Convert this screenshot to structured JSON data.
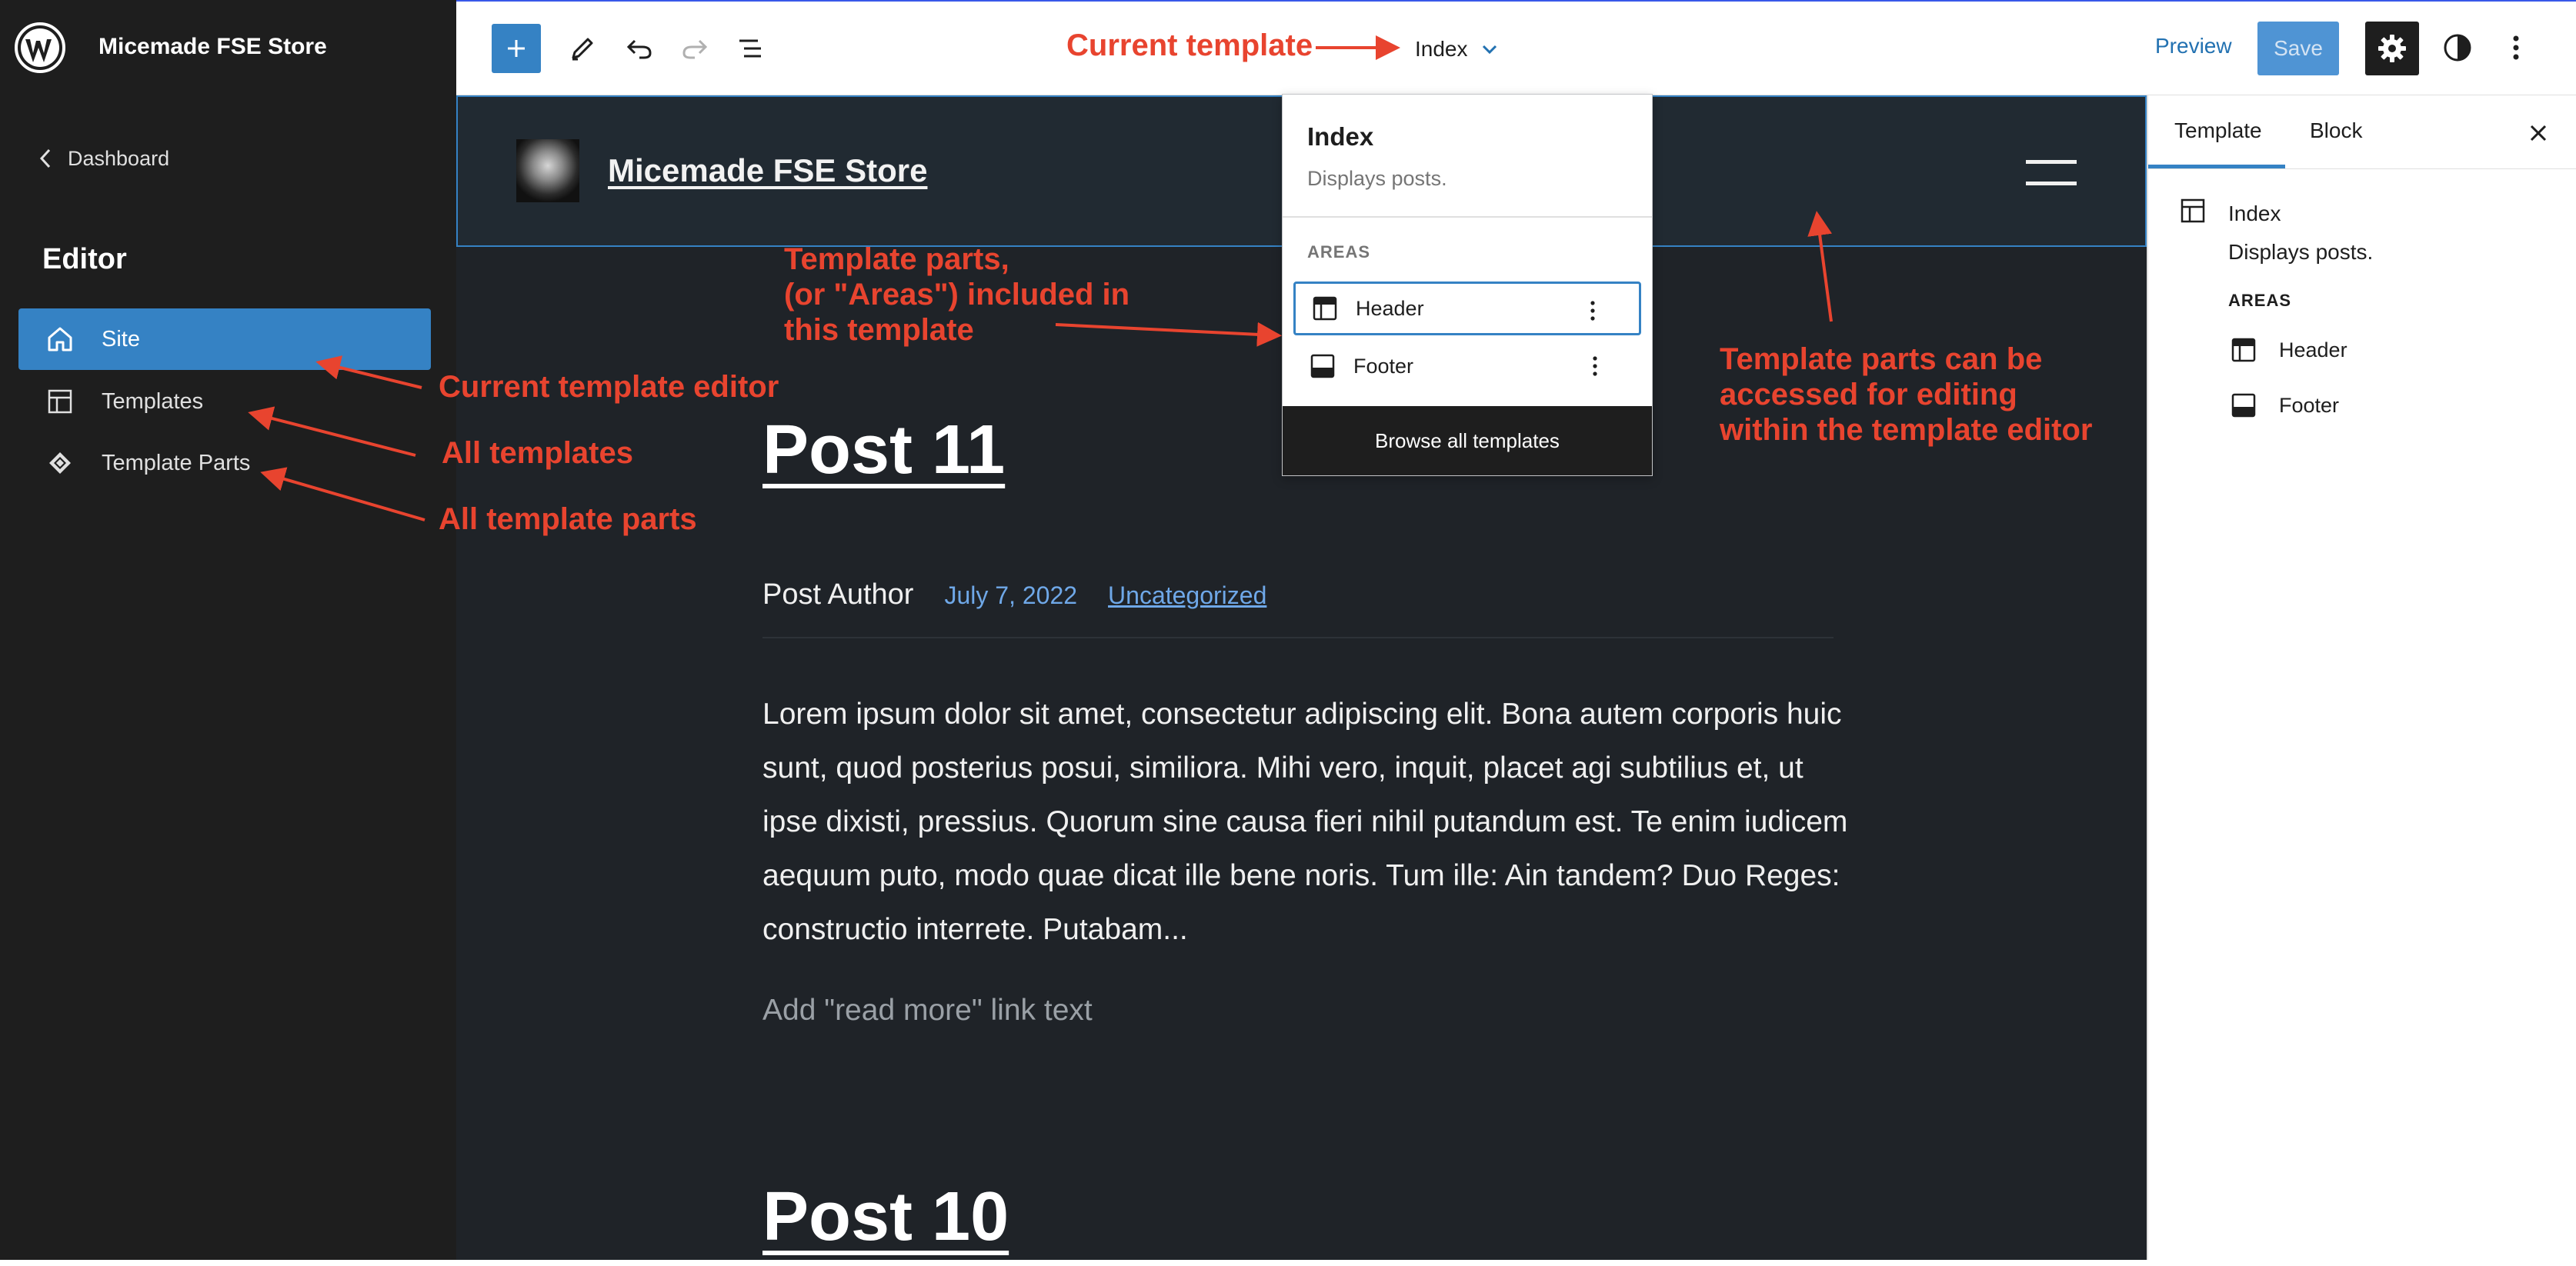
{
  "app": {
    "site_name": "Micemade FSE Store",
    "accent_color": "#3582c4",
    "annotation_color": "#e8442f"
  },
  "sidebar": {
    "back_link": "Dashboard",
    "heading": "Editor",
    "items": [
      {
        "label": "Site",
        "icon": "home-icon",
        "active": true
      },
      {
        "label": "Templates",
        "icon": "layout-icon",
        "active": false
      },
      {
        "label": "Template Parts",
        "icon": "symbol-icon",
        "active": false
      }
    ]
  },
  "toolbar": {
    "template_name": "Index",
    "preview_label": "Preview",
    "save_label": "Save",
    "icons": [
      "plus-icon",
      "pencil-icon",
      "undo-icon",
      "redo-icon",
      "list-view-icon",
      "gear-icon",
      "contrast-icon",
      "more-vertical-icon"
    ]
  },
  "template_dropdown": {
    "title": "Index",
    "description": "Displays posts.",
    "areas_heading": "AREAS",
    "areas": [
      {
        "label": "Header",
        "icon": "header-icon"
      },
      {
        "label": "Footer",
        "icon": "footer-icon"
      }
    ],
    "browse_label": "Browse all templates"
  },
  "canvas": {
    "site_title": "Micemade FSE Store",
    "posts": [
      {
        "title": "Post 11",
        "author": "Post Author",
        "date": "July 7, 2022",
        "category": "Uncategorized",
        "excerpt": "Lorem ipsum dolor sit amet, consectetur adipiscing elit. Bona autem corporis huic sunt, quod posterius posui, similiora. Mihi vero, inquit, placet agi subtilius et, ut ipse dixisti, pressius. Quorum sine causa fieri nihil putandum est. Te enim iudicem aequum puto, modo quae dicat ille bene noris. Tum ille: Ain tandem? Duo Reges: constructio interrete. Putabam...",
        "read_more": "Add \"read more\" link text"
      },
      {
        "title": "Post 10"
      }
    ]
  },
  "settings_panel": {
    "tabs": [
      "Template",
      "Block"
    ],
    "template_title": "Index",
    "template_description": "Displays posts.",
    "areas_heading": "AREAS",
    "areas": [
      {
        "label": "Header",
        "icon": "header-icon"
      },
      {
        "label": "Footer",
        "icon": "footer-icon"
      }
    ]
  },
  "annotations": {
    "current_template": "Current template",
    "template_parts_areas": "Template parts,\n(or \"Areas\") included in\nthis template",
    "template_parts_editing": "Template parts can be\naccessed for editing\nwithin the template editor",
    "current_template_editor": "Current template editor",
    "all_templates": "All templates",
    "all_template_parts": "All template parts"
  }
}
